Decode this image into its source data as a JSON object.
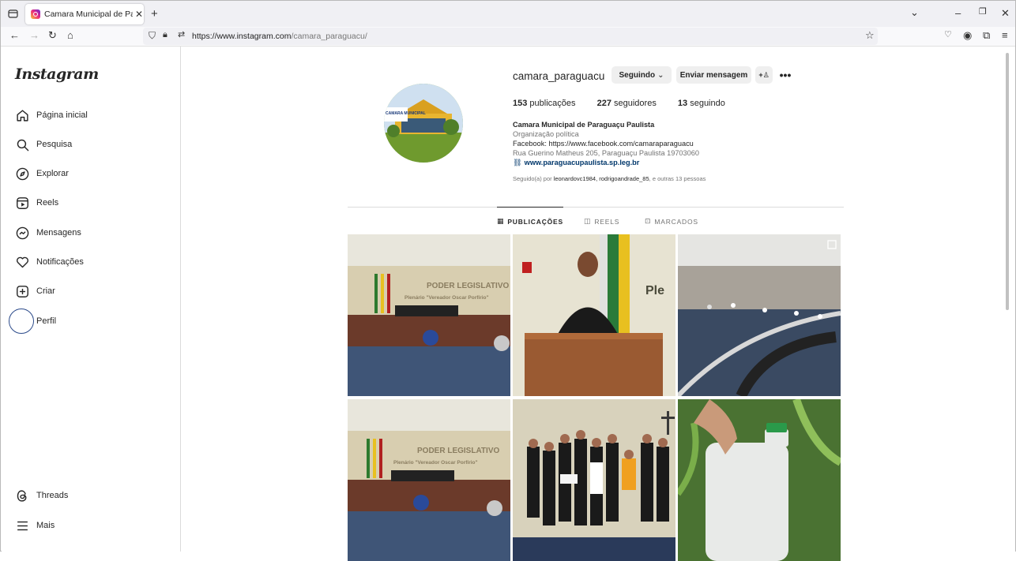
{
  "browser": {
    "tab_title": "Camara Municipal de Paraguaç",
    "url_host": "https://www.instagram.com",
    "url_path": "/camara_paraguacu/"
  },
  "sidebar": {
    "logo": "Instagram",
    "items": [
      {
        "label": "Página inicial",
        "icon": "home-icon"
      },
      {
        "label": "Pesquisa",
        "icon": "search-icon"
      },
      {
        "label": "Explorar",
        "icon": "compass-icon"
      },
      {
        "label": "Reels",
        "icon": "reels-icon"
      },
      {
        "label": "Mensagens",
        "icon": "messenger-icon"
      },
      {
        "label": "Notificações",
        "icon": "heart-icon"
      },
      {
        "label": "Criar",
        "icon": "plus-square-icon"
      },
      {
        "label": "Perfil",
        "icon": "avatar"
      }
    ],
    "bottom_items": [
      {
        "label": "Threads",
        "icon": "threads-icon"
      },
      {
        "label": "Mais",
        "icon": "menu-icon"
      }
    ]
  },
  "profile": {
    "username": "camara_paraguacu",
    "following_button": "Seguindo",
    "message_button": "Enviar mensagem",
    "posts_count": "153",
    "posts_label": "publicações",
    "followers_count": "227",
    "followers_label": "seguidores",
    "following_count": "13",
    "following_label": "seguindo",
    "name": "Camara Municipal de Paraguaçu Paulista",
    "category": "Organização política",
    "bio_line": "Facebook: https://www.facebook.com/camaraparaguacu",
    "address": "Rua Guerino Matheus 205, Paraguaçu Paulista 19703060",
    "website": "www.paraguacupaulista.sp.leg.br",
    "followed_prefix": "Seguido(a) por",
    "followed_users": "leonardovc1984, rodrigoandrade_85",
    "followed_suffix": ", e outras 13 pessoas"
  },
  "profile_tabs": [
    {
      "label": "PUBLICAÇÕES",
      "active": true
    },
    {
      "label": "REELS",
      "active": false
    },
    {
      "label": "MARCADOS",
      "active": false
    }
  ],
  "avatar_text": "CAMARA MUNICIPAL",
  "posts": [
    {
      "caption": "PODER LEGISLATIVO",
      "subcaption": "Plenário \"Vereador Oscar Porfírio\""
    },
    {
      "caption": "Ple"
    },
    {
      "caption": ""
    },
    {
      "caption": "PODER LEGISLATIVO",
      "subcaption": "Plenário \"Vereador Oscar Porfírio\""
    },
    {
      "caption": ""
    },
    {
      "caption": ""
    }
  ]
}
